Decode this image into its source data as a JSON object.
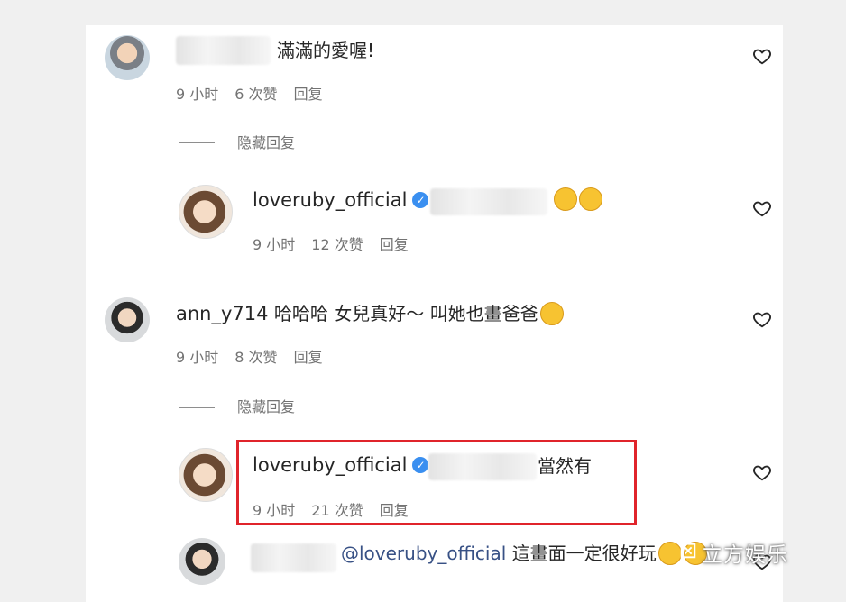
{
  "comments": [
    {
      "text": "滿滿的愛喔!",
      "time": "9 小时",
      "likes": "6 次赞",
      "reply": "回复",
      "hide_replies": "隐藏回复"
    },
    {
      "username": "loveruby_official",
      "time": "9 小时",
      "likes": "12 次赞",
      "reply": "回复"
    },
    {
      "username": "ann_y714",
      "text": "哈哈哈 女兒真好～ 叫她也畫爸爸",
      "time": "9 小时",
      "likes": "8 次赞",
      "reply": "回复",
      "hide_replies": "隐藏回复"
    },
    {
      "username": "loveruby_official",
      "text": "當然有",
      "time": "9 小时",
      "likes": "21 次赞",
      "reply": "回复"
    },
    {
      "mention": "@loveruby_official",
      "text": "這畫面一定很好玩"
    }
  ],
  "watermark": "立方娱乐",
  "colors": {
    "highlight": "#e0242b",
    "verified": "#3a8ff0",
    "mention": "#385185",
    "meta": "#737373"
  },
  "icons": [
    "heart-icon",
    "verified-icon",
    "rofl-emoji",
    "laugh-emoji",
    "sweat-laugh-emoji"
  ]
}
